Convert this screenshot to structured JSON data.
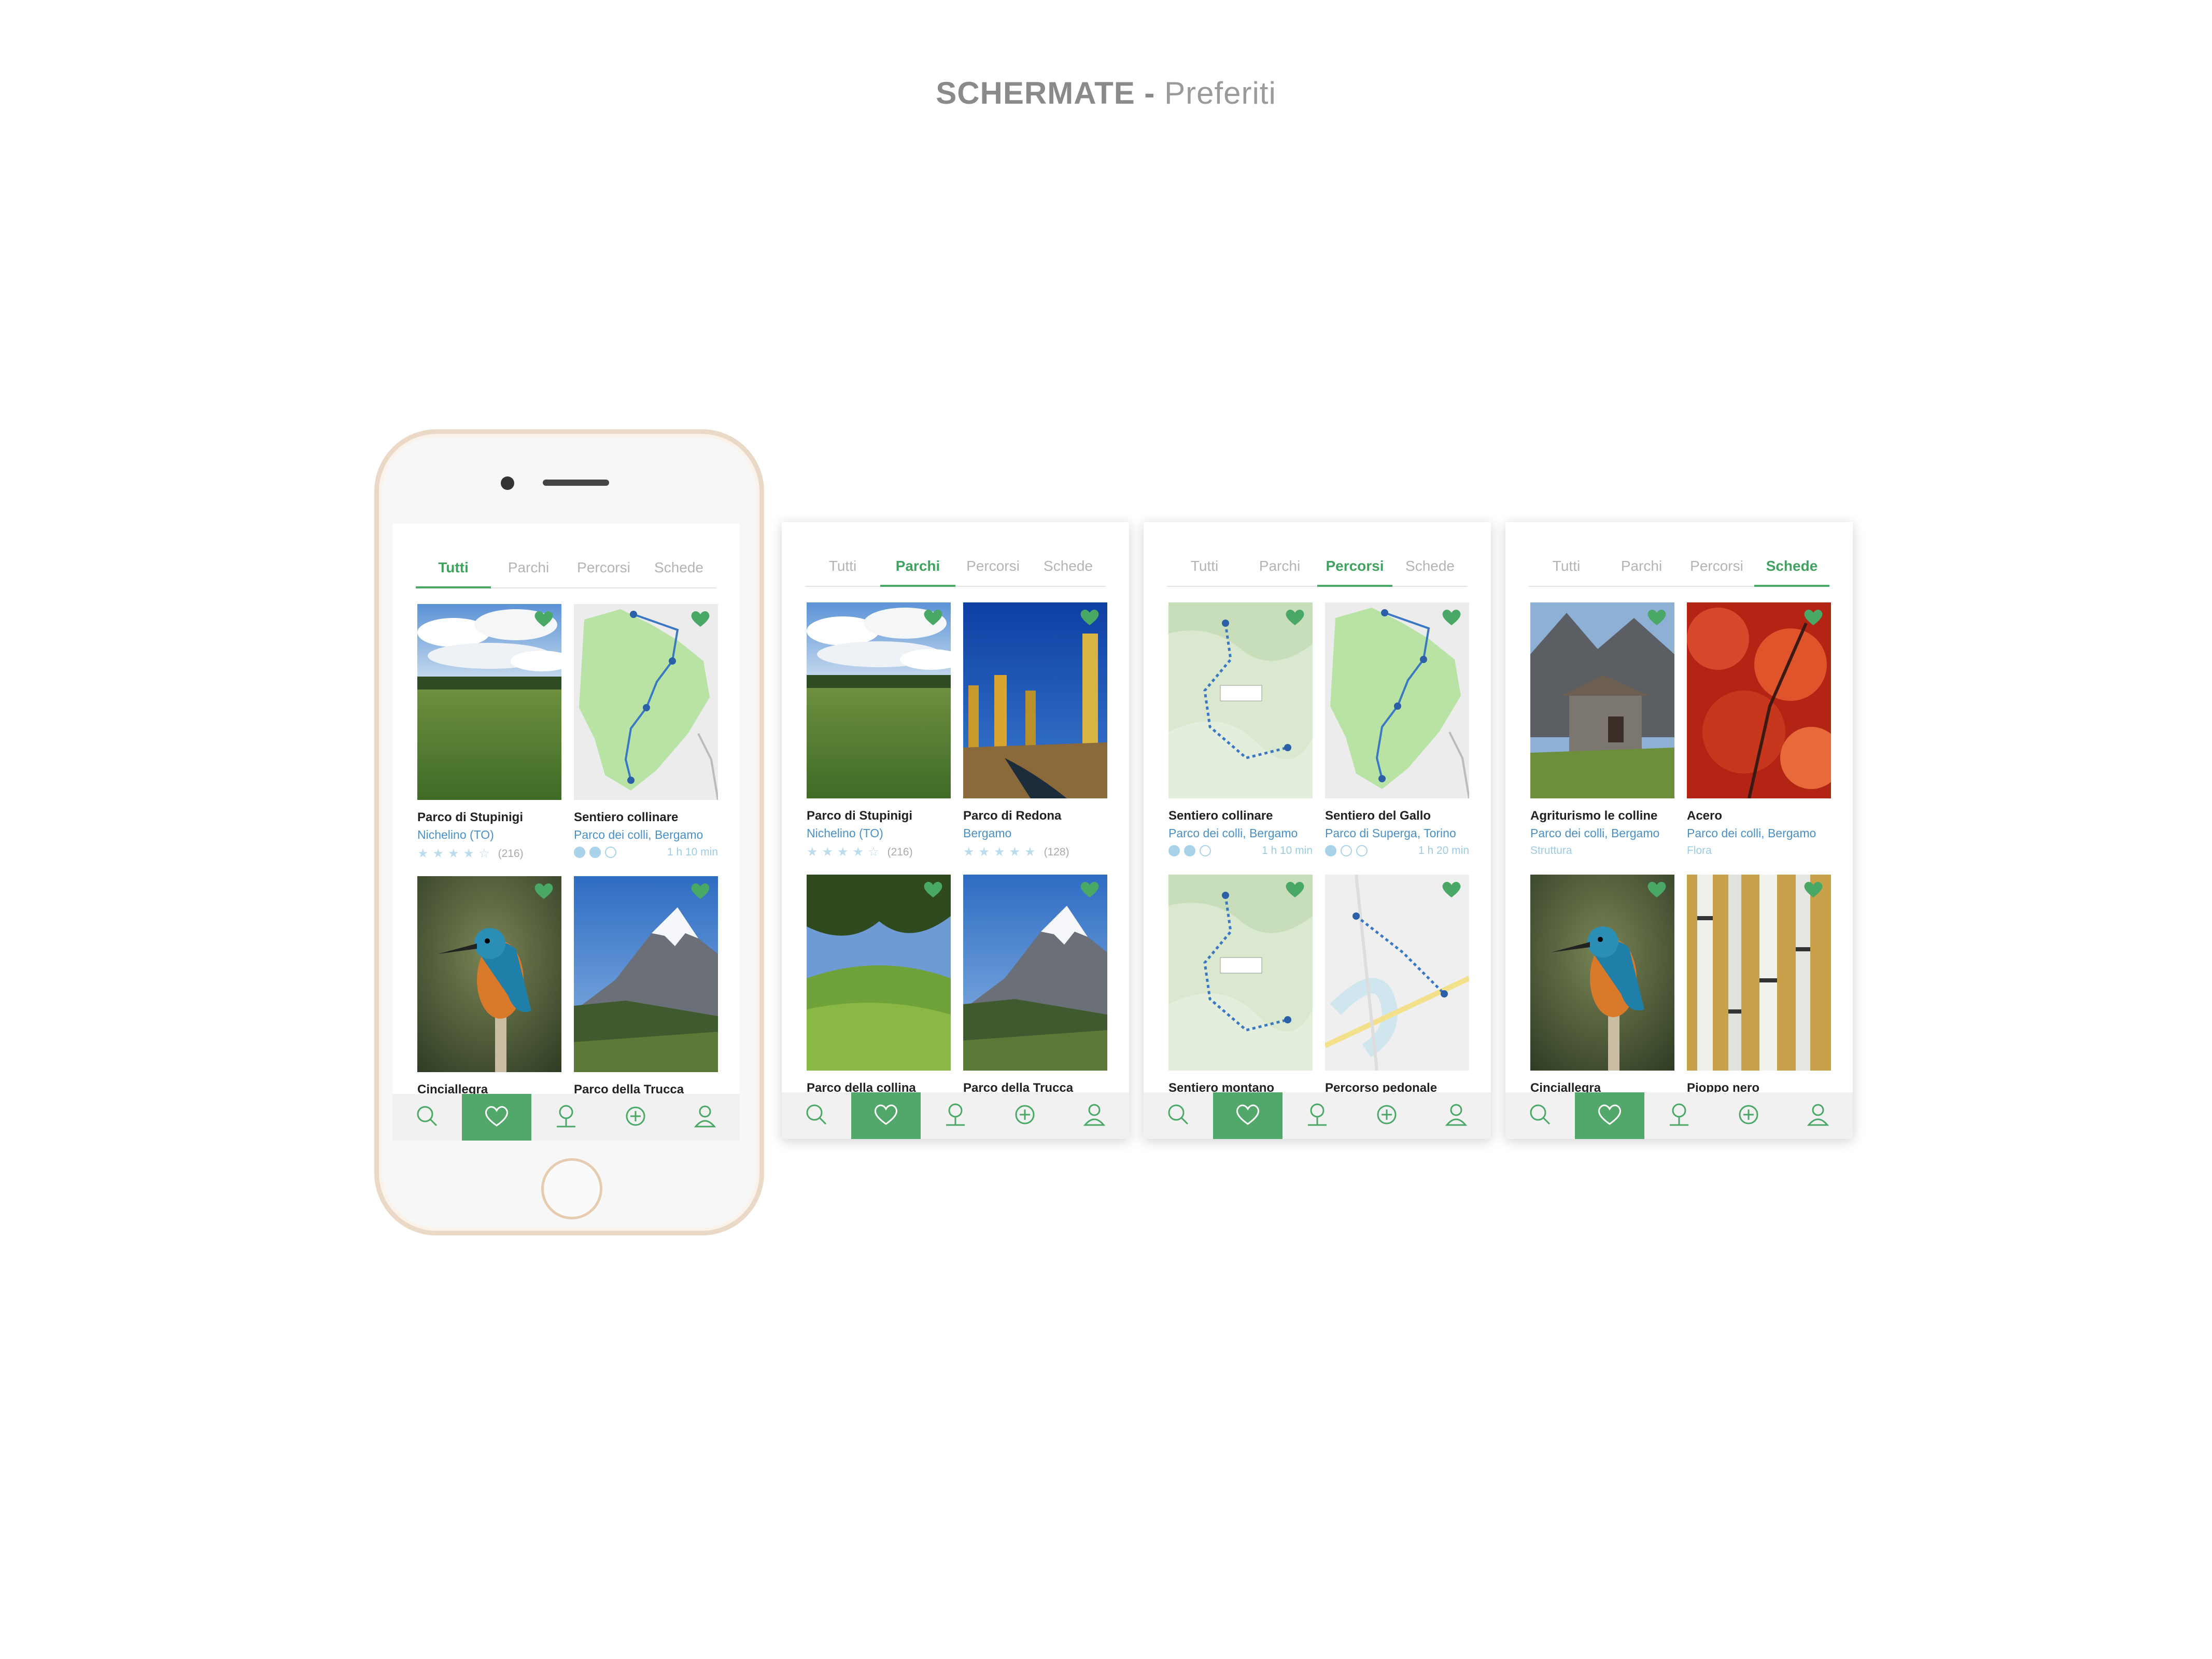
{
  "header": {
    "title_bold": "SCHERMATE -",
    "title_light": "Preferiti"
  },
  "tabs": [
    "Tutti",
    "Parchi",
    "Percorsi",
    "Schede"
  ],
  "colors": {
    "accent": "#4aa866",
    "link": "#4a90c8",
    "meta": "#9ccbe6"
  },
  "nav_icons": [
    "search-icon",
    "heart-icon",
    "tree-icon",
    "add-icon",
    "profile-icon"
  ],
  "screens": [
    {
      "active_tab": 0,
      "cards": [
        {
          "name": "Parco di Stupinigi",
          "sub": "Nichelino (TO)",
          "rating": 4,
          "count": "(216)",
          "image": "meadow"
        },
        {
          "name": "Sentiero collinare",
          "sub": "Parco dei colli, Bergamo",
          "difficulty": 2,
          "duration": "1 h 10 min",
          "image": "map"
        },
        {
          "name": "Cinciallegra",
          "image": "kingfisher"
        },
        {
          "name": "Parco della Trucca",
          "image": "mountain"
        }
      ]
    },
    {
      "active_tab": 1,
      "cards": [
        {
          "name": "Parco di Stupinigi",
          "sub": "Nichelino (TO)",
          "rating": 4,
          "count": "(216)",
          "image": "meadow"
        },
        {
          "name": "Parco di Redona",
          "sub": "Bergamo",
          "rating": 5,
          "count": "(128)",
          "image": "autumn"
        },
        {
          "name": "Parco della collina",
          "image": "hills"
        },
        {
          "name": "Parco della Trucca",
          "image": "mountain"
        }
      ]
    },
    {
      "active_tab": 2,
      "cards": [
        {
          "name": "Sentiero collinare",
          "sub": "Parco dei colli, Bergamo",
          "difficulty": 2,
          "duration": "1 h 10 min",
          "image": "topo"
        },
        {
          "name": "Sentiero del Gallo",
          "sub": "Parco di Superga, Torino",
          "difficulty": 1,
          "duration": "1 h 20 min",
          "image": "map"
        },
        {
          "name": "Sentiero montano",
          "image": "topo"
        },
        {
          "name": "Percorso pedonale",
          "image": "citymap"
        }
      ]
    },
    {
      "active_tab": 3,
      "cards": [
        {
          "name": "Agriturismo le colline",
          "sub": "Parco dei colli, Bergamo",
          "category": "Struttura",
          "image": "hut"
        },
        {
          "name": "Acero",
          "sub": "Parco dei colli, Bergamo",
          "category": "Flora",
          "image": "maple"
        },
        {
          "name": "Cinciallegra",
          "image": "kingfisher"
        },
        {
          "name": "Pioppo nero",
          "image": "birch"
        }
      ]
    }
  ]
}
